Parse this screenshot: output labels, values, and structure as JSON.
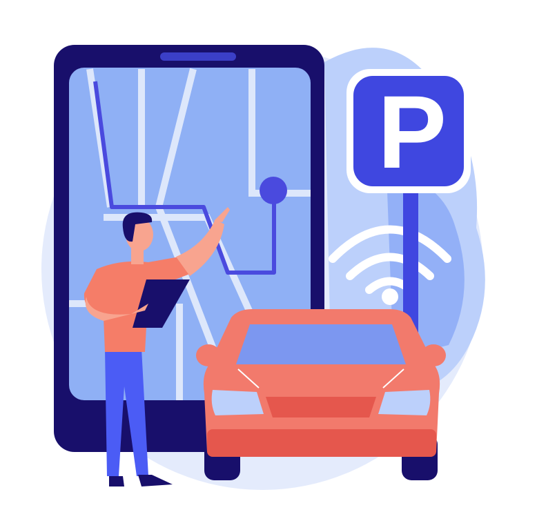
{
  "sign": {
    "letter": "P"
  },
  "colors": {
    "background_blob": "#e4ebfc",
    "background_blob_dark": "#bcd0fb",
    "phone_body": "#180f6b",
    "phone_screen": "#8fb0f5",
    "map_road": "#dde7fb",
    "route": "#4a4ade",
    "parking_sign": "#3f47e0",
    "car_body": "#f27a6c",
    "car_dark": "#e5574d",
    "car_window": "#7c97f0",
    "person_shirt": "#f57d68",
    "person_pants": "#4b5cf5",
    "person_hair": "#180f6b"
  }
}
